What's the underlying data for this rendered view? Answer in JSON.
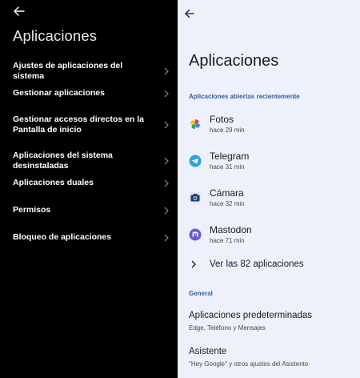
{
  "left": {
    "title": "Aplicaciones",
    "items": [
      {
        "label": "Ajustes de aplicaciones del sistema"
      },
      {
        "label": "Gestionar aplicaciones"
      },
      {
        "label": "Gestionar accesos directos en la Pantalla de inicio"
      },
      {
        "label": "Aplicaciones del sistema desinstaladas"
      },
      {
        "label": "Aplicaciones duales"
      },
      {
        "label": "Permisos"
      },
      {
        "label": "Bloqueo de aplicaciones"
      }
    ]
  },
  "right": {
    "title": "Aplicaciones",
    "recent_section": "Aplicaciones abiertas recientemente",
    "apps": [
      {
        "name": "Fotos",
        "time": "hace 29 min",
        "icon": "google-photos-icon"
      },
      {
        "name": "Telegram",
        "time": "hace 31 min",
        "icon": "telegram-icon"
      },
      {
        "name": "Cámara",
        "time": "hace 32 min",
        "icon": "camera-icon"
      },
      {
        "name": "Mastodon",
        "time": "hace 71 min",
        "icon": "mastodon-icon"
      }
    ],
    "see_all": "Ver las 82 aplicaciones",
    "general_section": "General",
    "prefs": [
      {
        "name": "Aplicaciones predeterminadas",
        "sub": "Edge, Teléfono y Mensajes"
      },
      {
        "name": "Asistente",
        "sub": "\"Hey Google\" y otros ajustes del Asistente"
      }
    ]
  },
  "colors": {
    "left_bg": "#000000",
    "right_bg": "#eef1fb",
    "section_accent": "#2f5f9c"
  }
}
